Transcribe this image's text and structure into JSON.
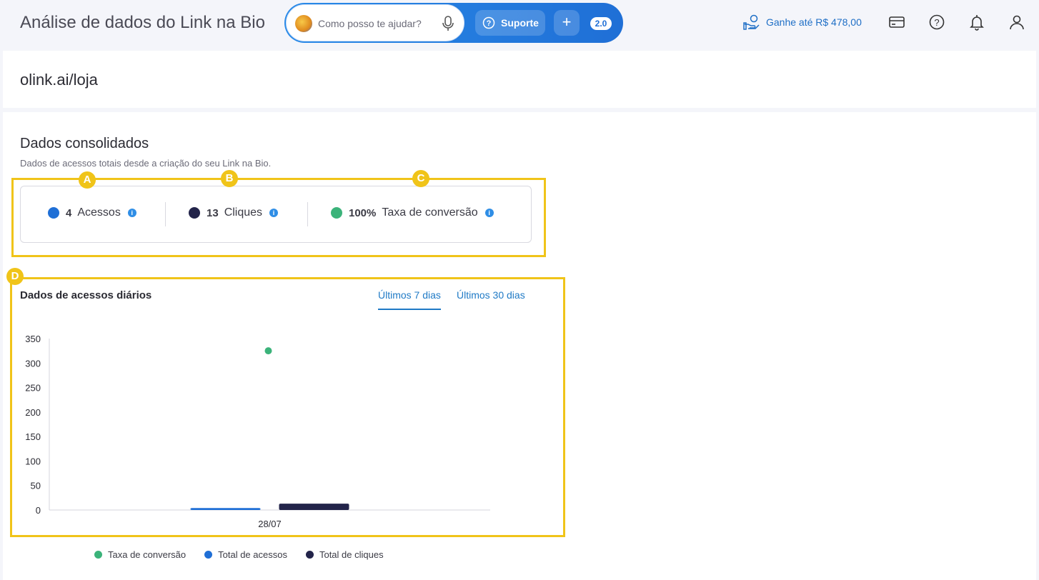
{
  "header": {
    "title": "Análise de dados do Link na Bio",
    "assistant": {
      "placeholder": "Como posso te ajudar?",
      "support_label": "Suporte",
      "plus_label": "+",
      "version": "2.0"
    },
    "earn_label": "Ganhe até R$ 478,00",
    "icons": [
      "card-icon",
      "help-icon",
      "bell-icon",
      "user-icon"
    ]
  },
  "url_panel": {
    "url": "olink.ai/loja"
  },
  "consolidated": {
    "title": "Dados consolidados",
    "subtitle": "Dados de acessos totais desde a criação do seu Link na Bio.",
    "stats": [
      {
        "value": "4",
        "label": "Acessos",
        "color": "#1f6fd6"
      },
      {
        "value": "13",
        "label": "Cliques",
        "color": "#23244a"
      },
      {
        "value": "100%",
        "label": "Taxa de conversão",
        "color": "#3bb37a"
      }
    ]
  },
  "daily": {
    "title": "Dados de acessos diários",
    "tabs": [
      {
        "label": "Últimos 7 dias",
        "active": true
      },
      {
        "label": "Últimos 30 dias",
        "active": false
      }
    ]
  },
  "annotations": [
    "A",
    "B",
    "C",
    "D"
  ],
  "chart_data": {
    "type": "bar",
    "categories": [
      "28/07"
    ],
    "series": [
      {
        "name": "Taxa de conversão",
        "type": "scatter",
        "values": [
          325
        ],
        "color": "#3bb37a"
      },
      {
        "name": "Total de acessos",
        "type": "bar",
        "values": [
          4
        ],
        "color": "#1f6fd6"
      },
      {
        "name": "Total de cliques",
        "type": "bar",
        "values": [
          13
        ],
        "color": "#23244a"
      }
    ],
    "yticks": [
      "350",
      "300",
      "250",
      "200",
      "150",
      "100",
      "50",
      "0"
    ],
    "ylim": [
      0,
      350
    ],
    "legend": "bottom"
  }
}
